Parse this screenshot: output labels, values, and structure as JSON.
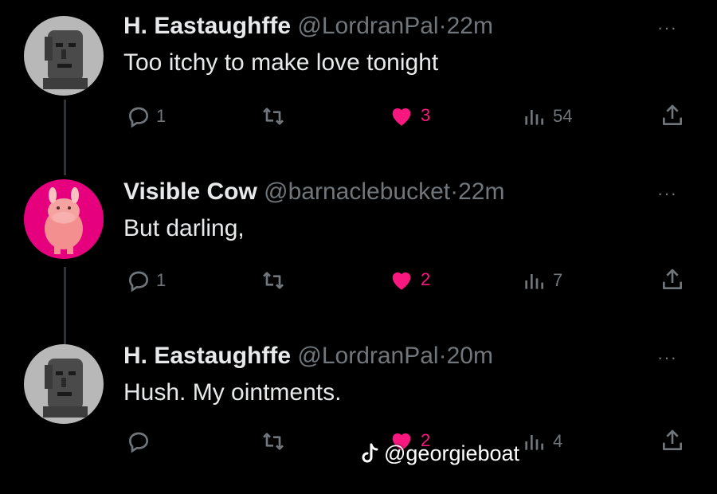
{
  "colors": {
    "background": "#000000",
    "text": "#e7e9ea",
    "muted": "#71767b",
    "like": "#f91880",
    "avatar_pink": "#e6007e"
  },
  "tweets": [
    {
      "name": "H. Eastaughffe",
      "handle": "@LordranPal",
      "dot": "·",
      "time": "22m",
      "text": "Too itchy to make love tonight",
      "more": "···",
      "avatar_icon": "stone-face-avatar",
      "replies": "1",
      "retweets": "",
      "likes": "3",
      "views": "54"
    },
    {
      "name": "Visible Cow",
      "handle": "@barnaclebucket",
      "dot": "·",
      "time": "22m",
      "text": "But darling,",
      "more": "···",
      "avatar_icon": "pink-cow-avatar",
      "replies": "1",
      "retweets": "",
      "likes": "2",
      "views": "7"
    },
    {
      "name": "H. Eastaughffe",
      "handle": "@LordranPal",
      "dot": "·",
      "time": "20m",
      "text": "Hush. My ointments.",
      "more": "···",
      "avatar_icon": "stone-face-avatar",
      "replies": "",
      "retweets": "",
      "likes": "2",
      "views": "4"
    }
  ],
  "watermark": {
    "text": "@georgieboat",
    "icon": "tiktok-icon"
  }
}
